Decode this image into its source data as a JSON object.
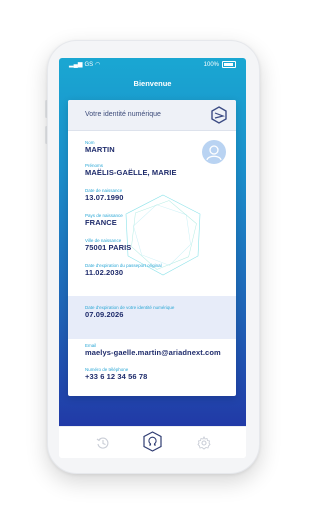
{
  "status_bar": {
    "carrier": "GS",
    "battery": "100%"
  },
  "header": {
    "title": "Bienvenue"
  },
  "card": {
    "header_title": "Votre identité numérique",
    "fields": {
      "nom": {
        "label": "Nom",
        "value": "MARTIN"
      },
      "prenoms": {
        "label": "Prénoms",
        "value": "MAËLIS-GAËLLE, MARIE"
      },
      "date_naissance": {
        "label": "Date de naissance",
        "value": "13.07.1990"
      },
      "pays_naissance": {
        "label": "Pays de naissance",
        "value": "FRANCE"
      },
      "ville_naissance": {
        "label": "Ville de naissance",
        "value": "75001 PARIS"
      },
      "expiration_passeport": {
        "label": "Date d'expiration du passeport original",
        "value": "11.02.2030"
      },
      "expiration_identite": {
        "label": "Date d'expiration de votre identité numérique",
        "value": "07.09.2026"
      },
      "email": {
        "label": "Email",
        "value": "maelys-gaelle.martin@ariadnext.com"
      },
      "telephone": {
        "label": "Numéro de téléphone",
        "value": "+33 6 12 34 56 78"
      }
    }
  },
  "nav": {
    "items": [
      "history-icon",
      "omega-icon",
      "settings-icon"
    ],
    "active": "omega-icon"
  },
  "colors": {
    "accent": "#2aa7d6",
    "text_dark": "#1e2b6b",
    "gradient_top": "#1aa7d2",
    "gradient_bottom": "#213aa7"
  }
}
